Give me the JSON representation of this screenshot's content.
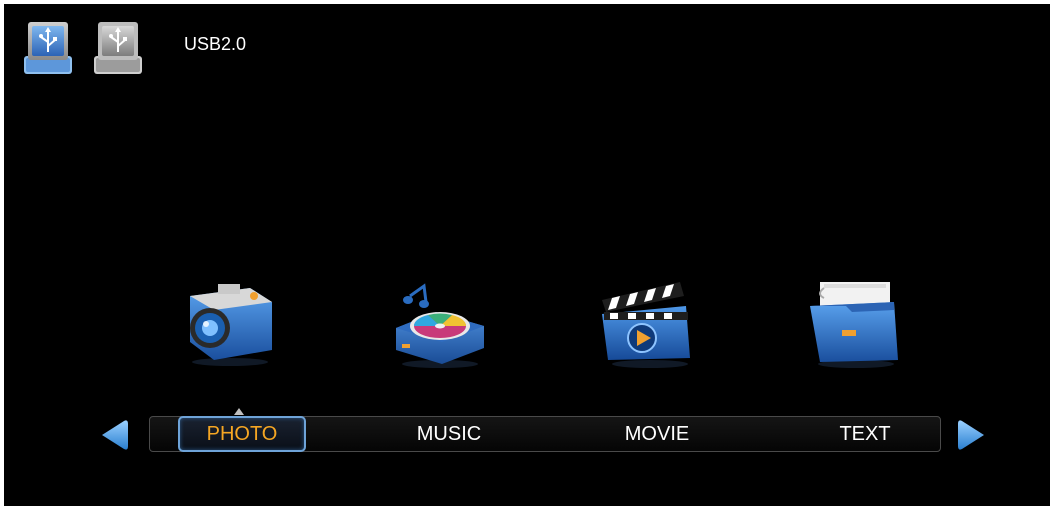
{
  "header": {
    "usb_label": "USB2.0",
    "drives": [
      {
        "icon": "usb-drive-icon",
        "state": "selected",
        "color": "#3f7fd0"
      },
      {
        "icon": "usb-drive-icon",
        "state": "normal",
        "color": "#a8a8a8"
      }
    ]
  },
  "media": {
    "icons": [
      "camera-icon",
      "music-disc-icon",
      "movie-clapper-icon",
      "text-folder-icon"
    ]
  },
  "menu": {
    "items": [
      {
        "label": "PHOTO",
        "active": true
      },
      {
        "label": "MUSIC",
        "active": false
      },
      {
        "label": "MOVIE",
        "active": false
      },
      {
        "label": "TEXT",
        "active": false
      }
    ],
    "active_color": "#f5a623",
    "highlight_border": "#6ea3d8"
  },
  "nav": {
    "left_icon": "arrow-left-icon",
    "right_icon": "arrow-right-icon",
    "accent": "#4aa3e8"
  }
}
